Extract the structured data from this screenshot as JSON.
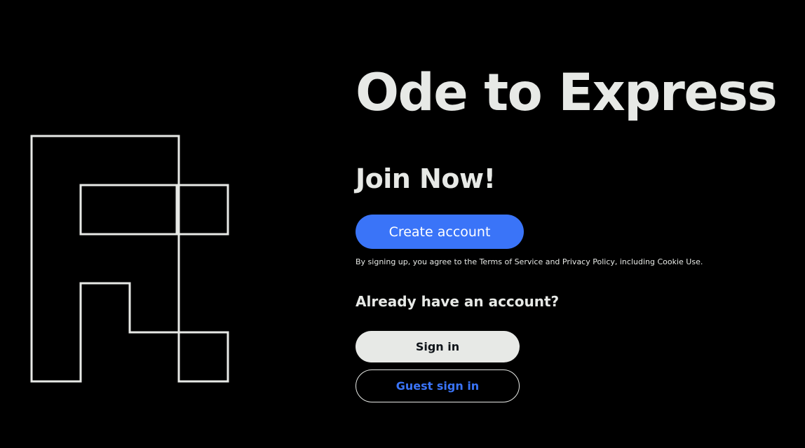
{
  "app": {
    "title": "Ode to Express"
  },
  "logo": {
    "icon": "logo-blocks-icon",
    "stroke_color": "#e7e9e6"
  },
  "signup": {
    "heading": "Join Now!",
    "create_account_label": "Create account",
    "terms_text": "By signing up, you agree to the Terms of Service and Privacy Policy, including Cookie Use."
  },
  "signin": {
    "prompt": "Already have an account?",
    "sign_in_label": "Sign in",
    "guest_sign_in_label": "Guest sign in"
  },
  "colors": {
    "background": "#000000",
    "text": "#e7e9e6",
    "accent": "#3a74f8",
    "sign_in_button_bg": "#e7e9e6",
    "sign_in_button_text": "#0f1419"
  }
}
